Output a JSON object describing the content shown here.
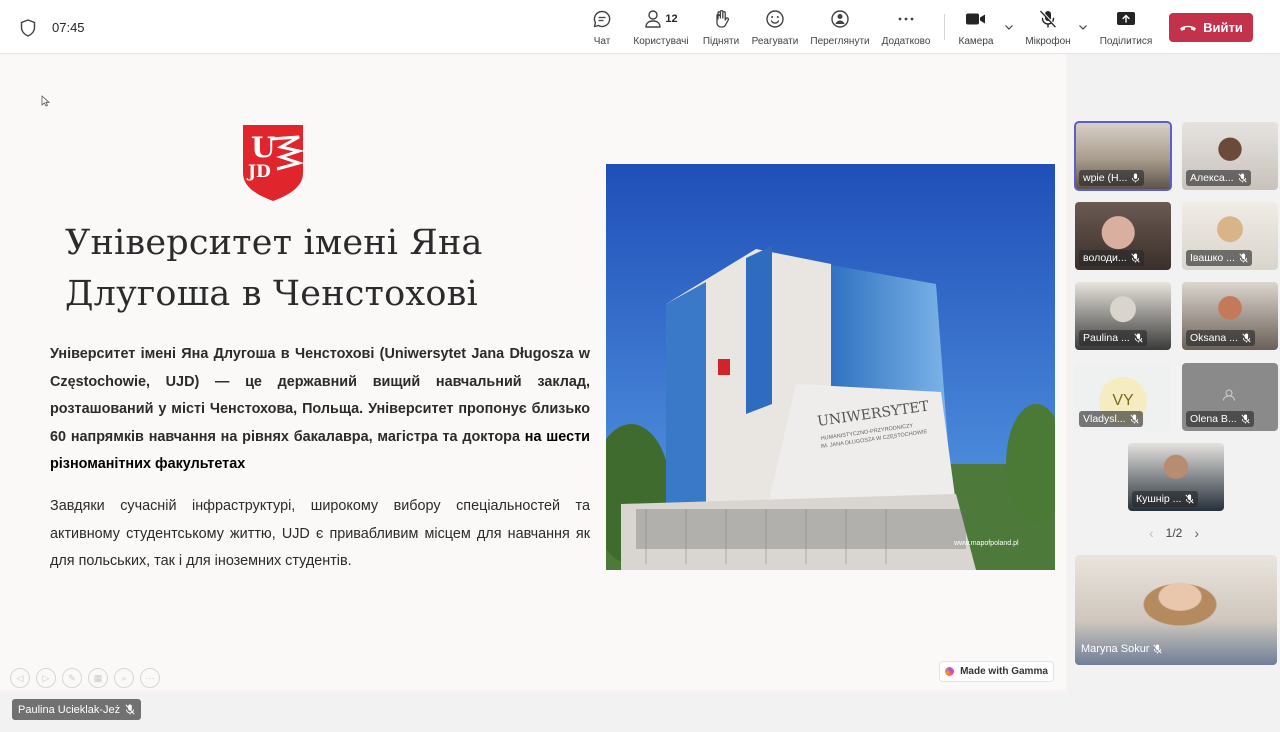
{
  "status": {
    "time": "07:45"
  },
  "toolbar": {
    "chat": "Чат",
    "people": "Користувачі",
    "people_count": "12",
    "raise": "Підняти",
    "react": "Реагувати",
    "view": "Переглянути",
    "more": "Додатково",
    "camera": "Камера",
    "mic": "Мікрофон",
    "share": "Поділитися",
    "leave": "Вийти"
  },
  "slide": {
    "title_line1": "Університет імені Яна",
    "title_line2": "Длугоша в Ченстохові",
    "para1": "Університет імені Яна Длугоша в Ченстохові (Uniwersytet Jana Długosza w Częstochowie, UJD) — це державний вищий навчальний заклад, розташований у місті Ченстохова, Польща. Університет пропонує близько 60 напрямків навчання на рівнях бакалавра, магістра та доктора",
    "para1_emph": " на шести різноманітних факультетах",
    "para2": "Завдяки сучасній інфраструктурі, широкому вибору спеціальностей та активному студентському життю, UJD є привабливим місцем для навчання як для польських, так і для іноземних студентів.",
    "photo_sign": "UNIWERSYTET",
    "photo_sign_sub1": "HUMANISTYCZNO-PRZYRODNICZY",
    "photo_sign_sub2": "IM. JANA DŁUGOSZA W CZĘSTOCHOWIE",
    "photo_watermark": "www.mapofpoland.pl",
    "gamma_badge": "Made with Gamma",
    "presenter_name": "Paulina Ucieklak-Jeż"
  },
  "participants": [
    {
      "name": "wpie (Н...",
      "active": true
    },
    {
      "name": "Алекса..."
    },
    {
      "name": "володи..."
    },
    {
      "name": "Івашко ..."
    },
    {
      "name": "Paulina ..."
    },
    {
      "name": "Oksana ..."
    },
    {
      "name": "Vladysl...",
      "initials": "VY"
    },
    {
      "name": "Olena B..."
    },
    {
      "name": "Кушнір ..."
    }
  ],
  "pager": {
    "label": "1/2"
  },
  "self_view": {
    "name": "Maryna Sokur"
  },
  "colors": {
    "leave": "#c4314b",
    "accent": "#5b5fc7",
    "logo_red": "#e0262c"
  }
}
